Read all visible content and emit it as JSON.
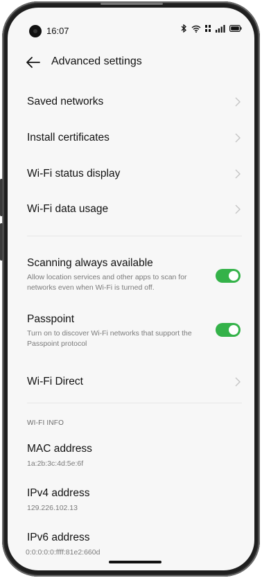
{
  "status": {
    "time": "16:07"
  },
  "header": {
    "title": "Advanced settings"
  },
  "nav_items": [
    {
      "label": "Saved networks"
    },
    {
      "label": "Install certificates"
    },
    {
      "label": "Wi-Fi status display"
    },
    {
      "label": "Wi-Fi data usage"
    }
  ],
  "toggles": [
    {
      "label": "Scanning always available",
      "description": "Allow location services and other apps to scan for networks even when Wi-Fi is turned off.",
      "on": true
    },
    {
      "label": "Passpoint",
      "description": "Turn on to discover Wi-Fi networks that support the Passpoint protocol",
      "on": true
    }
  ],
  "wifi_direct": {
    "label": "Wi-Fi Direct"
  },
  "wifi_info": {
    "section_title": "WI-FI INFO",
    "items": [
      {
        "label": "MAC address",
        "value": "1a:2b:3c:4d:5e:6f"
      },
      {
        "label": "IPv4 address",
        "value": "129.226.102.13"
      },
      {
        "label": "IPv6 address",
        "value": "0:0:0:0:0:ffff:81e2:660d"
      }
    ]
  },
  "colors": {
    "switch_on": "#34b249",
    "background": "#f7f7f7"
  }
}
